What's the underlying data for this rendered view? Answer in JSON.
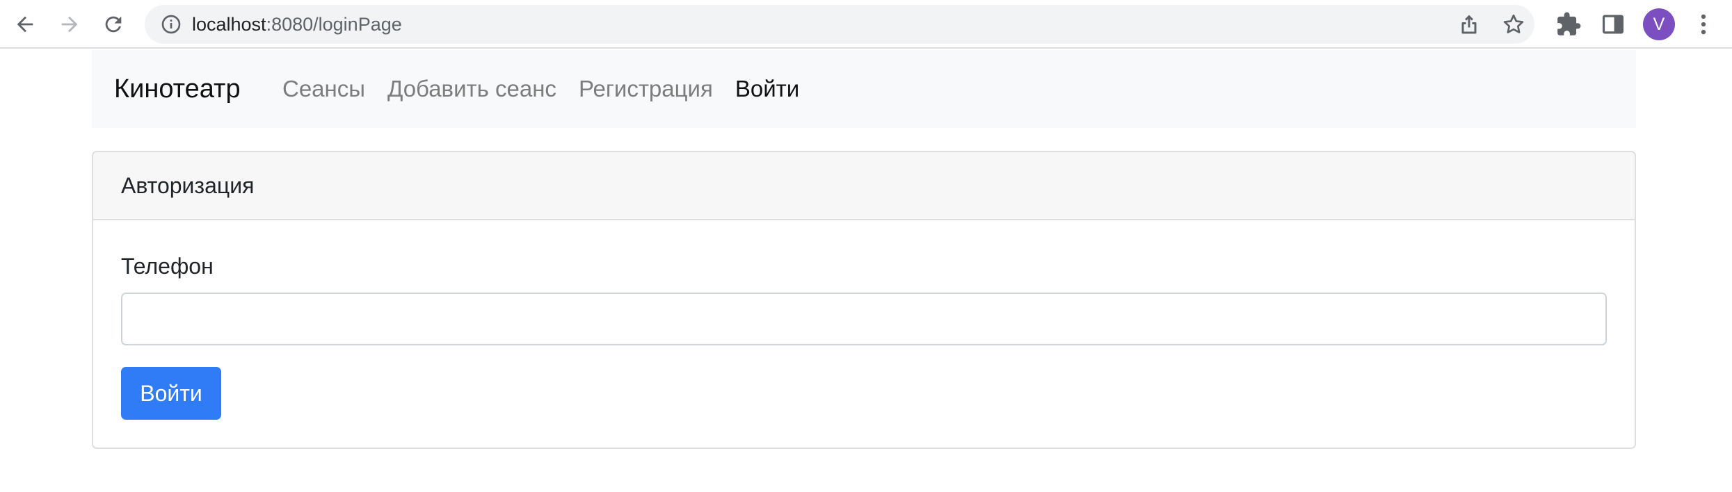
{
  "browser": {
    "url_host": "localhost",
    "url_rest": ":8080/loginPage",
    "avatar_letter": "V",
    "icons": [
      "back-arrow-icon",
      "forward-arrow-icon",
      "reload-icon",
      "info-icon",
      "share-icon",
      "star-icon",
      "extensions-icon",
      "side-panel-icon",
      "kebab-menu-icon"
    ]
  },
  "navbar": {
    "brand": "Кинотеатр",
    "links": [
      {
        "label": "Сеансы",
        "active": false
      },
      {
        "label": "Добавить сеанс",
        "active": false
      },
      {
        "label": "Регистрация",
        "active": false
      },
      {
        "label": "Войти",
        "active": true
      }
    ]
  },
  "card": {
    "header": "Авторизация",
    "phone_label": "Телефон",
    "phone_value": "",
    "submit_label": "Войти"
  },
  "colors": {
    "primary": "#2f7cf6",
    "navbar_bg": "#f8f9fa",
    "avatar_bg": "#7b4fbf"
  }
}
